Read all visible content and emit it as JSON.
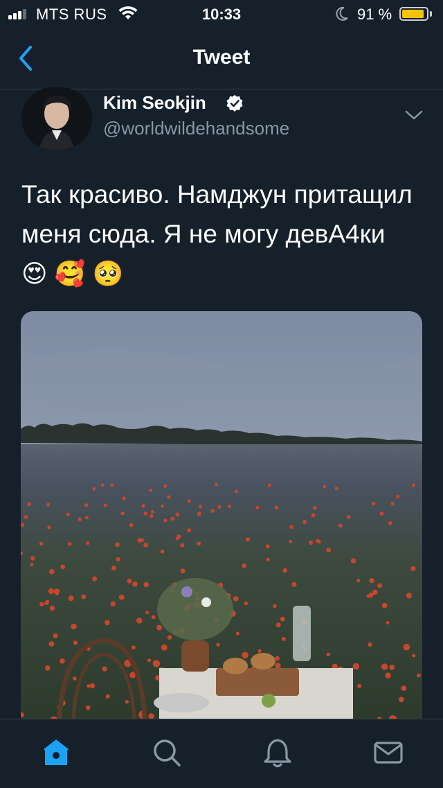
{
  "status_bar": {
    "carrier": "MTS RUS",
    "time": "10:33",
    "battery_percent": "91 %",
    "battery_level": 0.91,
    "battery_color": "#f5c400",
    "icons": [
      "signal-icon",
      "wifi-icon",
      "moon-icon",
      "battery-icon"
    ]
  },
  "nav": {
    "title": "Tweet",
    "back_icon": "chevron-left-icon",
    "accent": "#1da1f2"
  },
  "tweet": {
    "author_name": "Kim Seokjin",
    "author_handle": "@worldwildehandsome",
    "verified": true,
    "text": "Так красиво. Намджун притащил меня сюда. Я не могу девА4ки",
    "emojis": [
      "😍",
      "🥰",
      "🥺"
    ],
    "media": "photo of a picnic table in a poppy field"
  },
  "tab_bar": {
    "tabs": [
      {
        "name": "home",
        "icon": "home-icon",
        "active": true
      },
      {
        "name": "search",
        "icon": "search-icon",
        "active": false
      },
      {
        "name": "notifications",
        "icon": "bell-icon",
        "active": false
      },
      {
        "name": "messages",
        "icon": "mail-icon",
        "active": false
      }
    ]
  },
  "colors": {
    "background": "#15202b",
    "secondary_text": "#8899a6",
    "divider": "#38444d",
    "accent": "#1da1f2"
  }
}
